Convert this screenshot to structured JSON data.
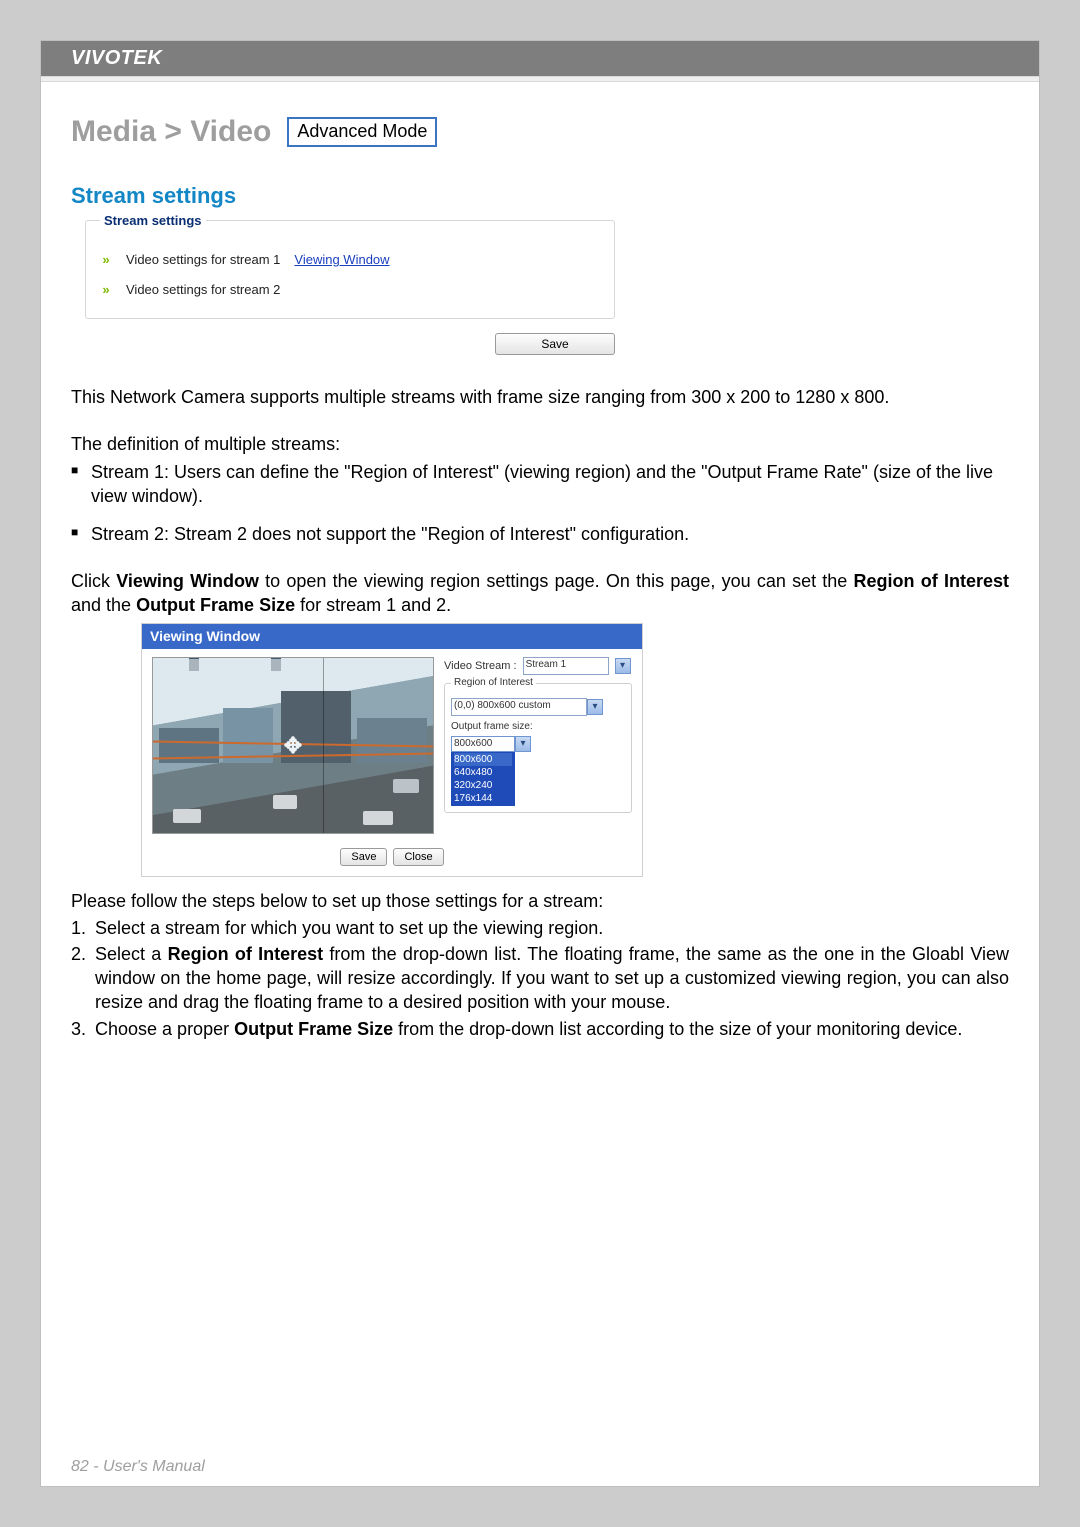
{
  "header": {
    "brand": "VIVOTEK"
  },
  "breadcrumb": {
    "path": "Media > Video",
    "mode_badge": "Advanced Mode"
  },
  "section_title": "Stream settings",
  "stream_panel": {
    "legend": "Stream settings",
    "rows": [
      {
        "label": "Video settings for stream 1",
        "link": "Viewing Window"
      },
      {
        "label": "Video settings for stream 2",
        "link": ""
      }
    ],
    "save_label": "Save"
  },
  "paragraphs": {
    "intro": "This Network Camera supports multiple streams with frame size ranging from 300 x 200 to 1280 x 800.",
    "def_heading": "The definition of multiple streams:",
    "bullet1": "Stream 1: Users can define the \"Region of Interest\" (viewing region) and the \"Output Frame Rate\" (size of the live view window).",
    "bullet2": "Stream 2: Stream 2 does not support the \"Region of Interest\" configuration.",
    "click_pre": "Click ",
    "click_bold1": "Viewing Window",
    "click_mid": " to open the viewing region settings page. On this page, you can set the ",
    "click_bold2": "Region of Interest",
    "click_mid2": " and the ",
    "click_bold3": "Output Frame Size",
    "click_post": " for stream 1 and 2.",
    "steps_intro": "Please follow the steps below to set up those settings for a stream:",
    "step1": "Select a stream for which you want to set up the viewing region.",
    "step2_pre": "Select a ",
    "step2_bold": "Region of Interest",
    "step2_post": " from the drop-down list. The floating frame, the same as the one in the Gloabl View window on the home page, will resize accordingly. If you want to set up a customized viewing region, you can also resize and drag the floating frame to a desired position with your mouse.",
    "step3_pre": "Choose a proper ",
    "step3_bold": "Output Frame Size",
    "step3_post": " from the drop-down list according to the size of your monitoring device."
  },
  "viewing_window": {
    "title": "Viewing Window",
    "video_stream_label": "Video Stream :",
    "video_stream_value": "Stream 1",
    "roi_legend": "Region of Interest",
    "roi_value": "(0,0) 800x600 custom",
    "ofs_label": "Output frame size:",
    "ofs_selected": "800x600",
    "ofs_options": [
      "800x600",
      "640x480",
      "320x240",
      "176x144"
    ],
    "save_label": "Save",
    "close_label": "Close"
  },
  "footer": {
    "page": "82 - User's Manual"
  }
}
